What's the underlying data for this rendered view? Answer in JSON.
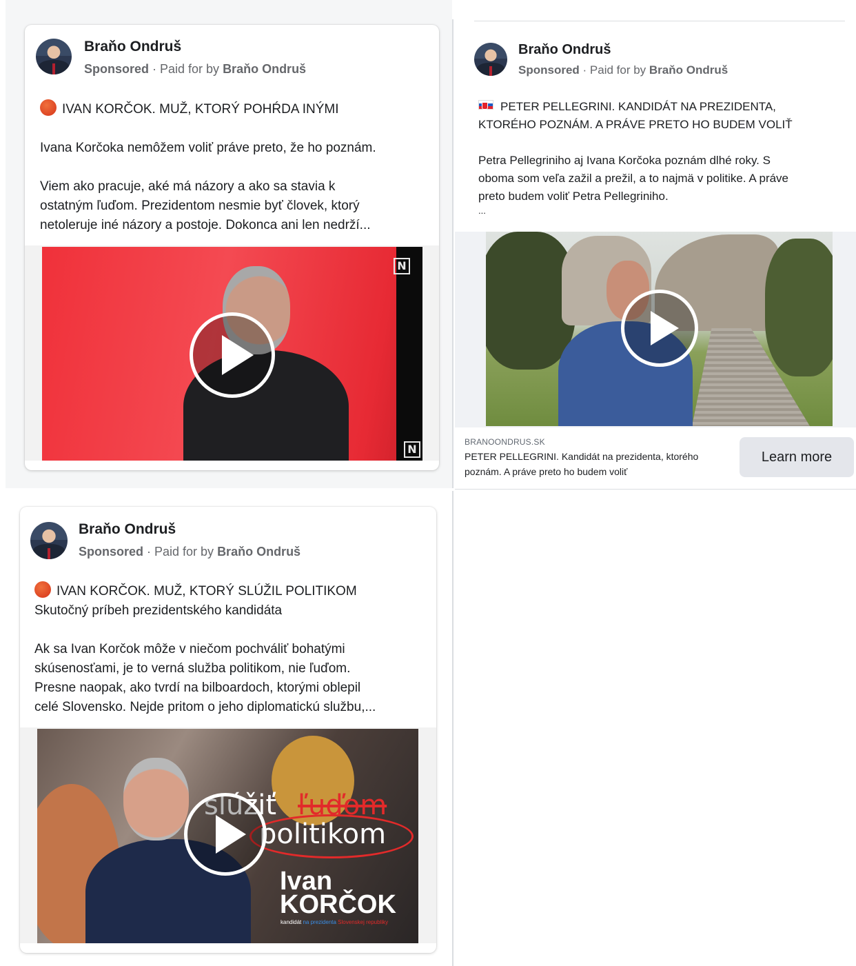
{
  "colors": {
    "page_bg": "#ffffff",
    "card_bg": "#ffffff",
    "text_primary": "#1c1e21",
    "text_secondary": "#65676b",
    "button_bg": "#e4e6eb",
    "media_red": "#f0313a"
  },
  "ads": [
    {
      "author": "Braňo Ondruš",
      "sponsored": "Sponsored",
      "paid_prefix": " · Paid for by ",
      "paid_by": "Braňo Ondruš",
      "headline_icon": "stop-sign-icon",
      "headline": "IVAN KORČOK. MUŽ, KTORÝ POHŔDA INÝMI",
      "paragraph1": "Ivana Korčoka nemôžem voliť práve preto, že ho poznám.",
      "paragraph2_line1": "Viem ako pracuje, aké má názory a ako sa stavia k",
      "paragraph2_line2": "ostatným ľuďom. Prezidentom nesmie byť človek, ktorý",
      "paragraph2_line3": "netoleruje iné názory a postoje. Dokonca ani len nedrží...",
      "media_icon": "play-icon",
      "media_watermark": "N"
    },
    {
      "author": "Braňo Ondruš",
      "sponsored": "Sponsored",
      "paid_prefix": " · Paid for by ",
      "paid_by": "Braňo Ondruš",
      "headline_icon": "slovak-flag-icon",
      "headline_line1": "PETER PELLEGRINI. KANDIDÁT NA PREZIDENTA,",
      "headline_line2": "KTORÉHO POZNÁM. A PRÁVE PRETO HO BUDEM VOLIŤ",
      "paragraph1_line1": "Petra Pellegriniho aj Ivana Korčoka poznám dlhé roky. S",
      "paragraph1_line2": "oboma som veľa zažil a prežil, a to najmä v politike. A práve",
      "paragraph1_line3": "preto budem voliť Petra Pellegriniho.",
      "ellipsis": "...",
      "media_icon": "play-icon",
      "link_domain": "BRANOONDRUS.SK",
      "link_title_line1": "PETER PELLEGRINI. Kandidát na prezidenta, ktorého",
      "link_title_line2": "poznám. A práve preto ho budem voliť",
      "cta": "Learn more"
    },
    {
      "author": "Braňo Ondruš",
      "sponsored": "Sponsored",
      "paid_prefix": " · Paid for by ",
      "paid_by": "Braňo Ondruš",
      "headline_icon": "stop-sign-icon",
      "headline": "IVAN KORČOK. MUŽ, KTORÝ SLÚŽIL POLITIKOM",
      "subheadline": "Skutočný príbeh prezidentského kandidáta",
      "paragraph1_line1": "Ak sa Ivan Korčok môže v niečom pochváliť bohatými",
      "paragraph1_line2": "skúsenosťami, je to verná služba politikom, nie ľuďom.",
      "paragraph1_line3": "Presne naopak, ako tvrdí na bilboardoch, ktorými oblepil",
      "paragraph1_line4": "celé Slovensko. Nejde pritom o jeho diplomatickú službu,...",
      "media_icon": "play-icon",
      "overlay_word1": "slúžiť",
      "overlay_word_struck": "ľuďom",
      "overlay_word2": "politikom",
      "overlay_name1": "Ivan",
      "overlay_name2": "KORČOK",
      "overlay_tag_a": "kandidát ",
      "overlay_tag_b": "na prezidenta",
      "overlay_tag_c": " Slovenskej republiky"
    }
  ]
}
